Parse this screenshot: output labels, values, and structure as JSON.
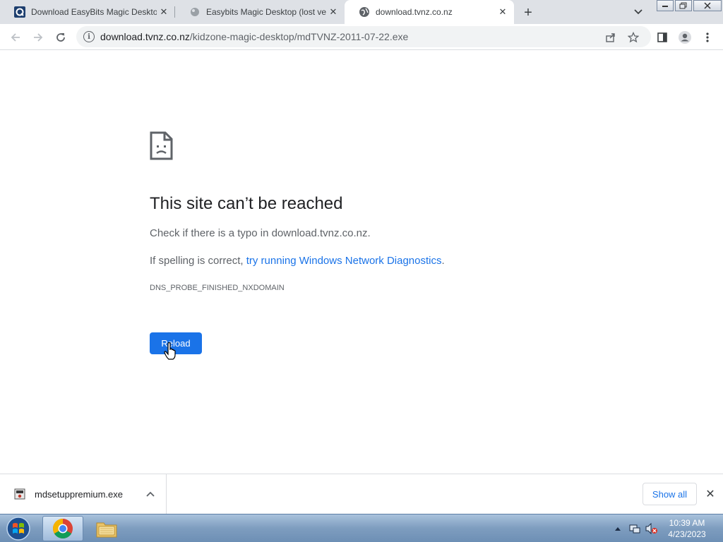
{
  "tabs": [
    {
      "title": "Download EasyBits Magic Deskto",
      "favicon": "easybits-favicon"
    },
    {
      "title": "Easybits Magic Desktop (lost vers",
      "favicon": "loading-favicon"
    },
    {
      "title": "download.tvnz.co.nz",
      "favicon": "globe-icon",
      "active": true
    }
  ],
  "address_bar": {
    "host": "download.tvnz.co.nz",
    "path": "/kidzone-magic-desktop/mdTVNZ-2011-07-22.exe"
  },
  "error_page": {
    "title": "This site can’t be reached",
    "line1": "Check if there is a typo in download.tvnz.co.nz.",
    "line2_prefix": "If spelling is correct, ",
    "line2_link": "try running Windows Network Diagnostics",
    "line2_suffix": ".",
    "error_code": "DNS_PROBE_FINISHED_NXDOMAIN",
    "reload_label": "Reload"
  },
  "download_shelf": {
    "filename": "mdsetuppremium.exe",
    "show_all_label": "Show all"
  },
  "taskbar": {
    "time": "10:39 AM",
    "date": "4/23/2023"
  },
  "colors": {
    "accent": "#1a73e8",
    "tabstrip": "#dee1e6"
  }
}
